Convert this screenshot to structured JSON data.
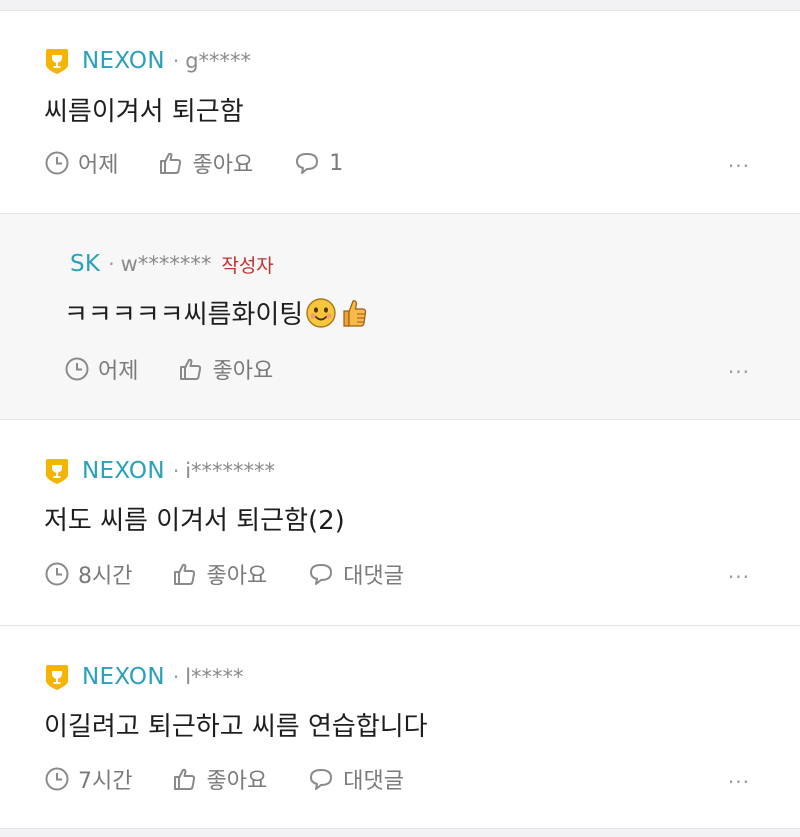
{
  "comments": [
    {
      "company": "NEXON",
      "user": "g*****",
      "text": "씨름이겨서 퇴근함",
      "time": "어제",
      "like_label": "좋아요",
      "reply_label": "1",
      "more": "···"
    },
    {
      "company": "SK",
      "user": "w*******",
      "author_tag": "작성자",
      "text": "ㅋㅋㅋㅋㅋ씨름화이팅",
      "time": "어제",
      "like_label": "좋아요",
      "more": "···",
      "emojis": [
        "smiling-face-icon",
        "thumbs-up-icon"
      ]
    },
    {
      "company": "NEXON",
      "user": "i********",
      "text": "저도 씨름 이겨서 퇴근함(2)",
      "time": "8시간",
      "like_label": "좋아요",
      "reply_label": "대댓글",
      "more": "···"
    },
    {
      "company": "NEXON",
      "user": "l*****",
      "text": "이길려고 퇴근하고 씨름 연습합니다",
      "time": "7시간",
      "like_label": "좋아요",
      "reply_label": "대댓글",
      "more": "···"
    }
  ],
  "colors": {
    "company": "#2aa0bd",
    "author_tag": "#c0332f",
    "badge": "#f4b400",
    "reply_bg": "#f7f7f8"
  }
}
